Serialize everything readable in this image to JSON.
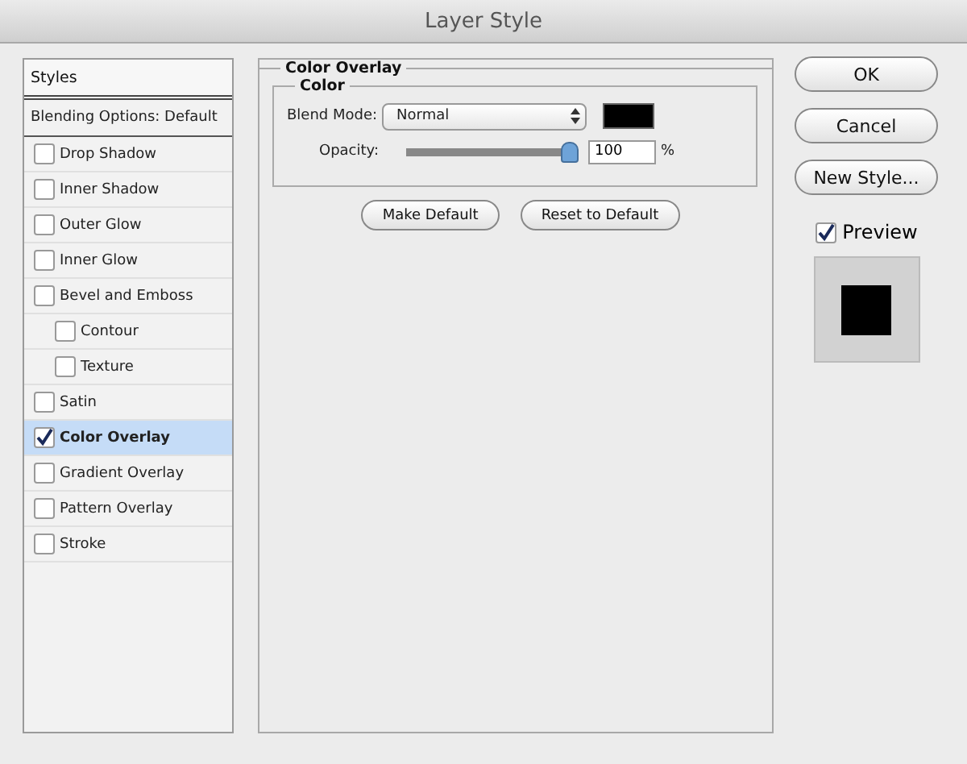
{
  "window": {
    "title": "Layer Style"
  },
  "sidebar": {
    "header": "Styles",
    "blending_options": {
      "label": "Blending Options: Default",
      "selected": false
    },
    "items": [
      {
        "label": "Drop Shadow",
        "checked": false,
        "selected": false
      },
      {
        "label": "Inner Shadow",
        "checked": false,
        "selected": false
      },
      {
        "label": "Outer Glow",
        "checked": false,
        "selected": false
      },
      {
        "label": "Inner Glow",
        "checked": false,
        "selected": false
      },
      {
        "label": "Bevel and Emboss",
        "checked": false,
        "selected": false,
        "children": [
          {
            "label": "Contour",
            "checked": false,
            "selected": false
          },
          {
            "label": "Texture",
            "checked": false,
            "selected": false
          }
        ]
      },
      {
        "label": "Satin",
        "checked": false,
        "selected": false
      },
      {
        "label": "Color Overlay",
        "checked": true,
        "selected": true
      },
      {
        "label": "Gradient Overlay",
        "checked": false,
        "selected": false
      },
      {
        "label": "Pattern Overlay",
        "checked": false,
        "selected": false
      },
      {
        "label": "Stroke",
        "checked": false,
        "selected": false
      }
    ]
  },
  "panel": {
    "title": "Color Overlay",
    "group": {
      "title": "Color",
      "blend_mode": {
        "label": "Blend Mode:",
        "value": "Normal"
      },
      "opacity": {
        "label": "Opacity:",
        "level": 1.0,
        "value": "100",
        "unit": "%"
      }
    },
    "buttons": [
      "Make Default",
      "Reset to Default"
    ]
  },
  "actions": {
    "buttons": [
      "OK",
      "Cancel",
      "New Style..."
    ],
    "preview": {
      "label": "Preview",
      "checked": true
    }
  }
}
